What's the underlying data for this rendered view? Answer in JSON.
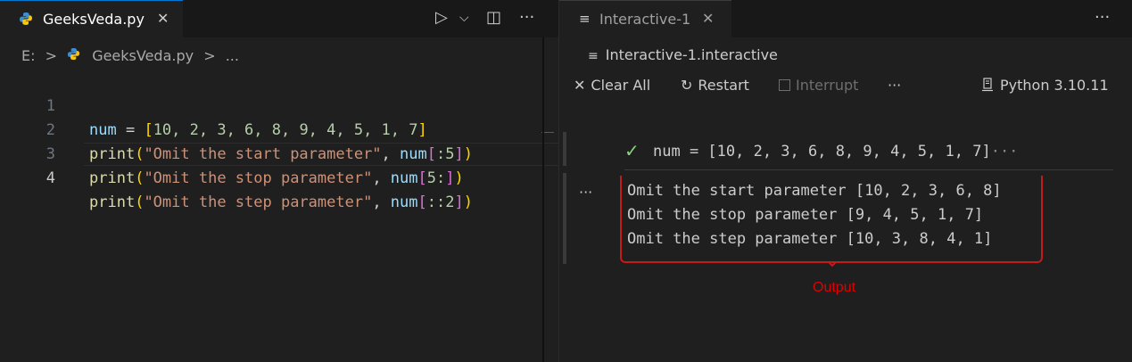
{
  "left_editor": {
    "tab": {
      "title": "GeeksVeda.py",
      "close": "✕"
    },
    "toolbar": {
      "run": "▷",
      "run_menu": "⌵",
      "split": "◫",
      "more": "···"
    },
    "breadcrumb": {
      "drive": "E:",
      "sep1": ">",
      "file": "GeeksVeda.py",
      "sep2": ">",
      "more": "..."
    },
    "lines": [
      {
        "n": "1",
        "tokens": [
          "num",
          " = ",
          "[",
          "10, 2, 3, 6, 8, 9, 4, 5, 1, 7",
          "]"
        ]
      },
      {
        "n": "2",
        "tokens": [
          "print",
          "(",
          "\"Omit the start parameter\"",
          ", ",
          "num",
          "[",
          ":5",
          "]",
          ")"
        ]
      },
      {
        "n": "3",
        "tokens": [
          "print",
          "(",
          "\"Omit the stop parameter\"",
          ", ",
          "num",
          "[",
          "5:",
          "]",
          ")"
        ]
      },
      {
        "n": "4",
        "tokens": [
          "print",
          "(",
          "\"Omit the step parameter\"",
          ", ",
          "num",
          "[",
          "::2",
          "]",
          ")"
        ]
      }
    ]
  },
  "right_panel": {
    "tab": {
      "title": "Interactive-1",
      "close": "✕",
      "icon": "list-icon"
    },
    "more": "···",
    "breadcrumb": "Interactive-1.interactive",
    "toolbar": {
      "clear_all": "Clear All",
      "restart": "Restart",
      "interrupt": "Interrupt",
      "more": "···",
      "kernel": "Python 3.10.11"
    },
    "cell_input": "num = [10, 2, 3, 6, 8, 9, 4, 5, 1, 7]",
    "cell_input_more": "···",
    "output_more": "···",
    "output_lines": [
      "Omit the start parameter [10, 2, 3, 6, 8]",
      "Omit the stop parameter [9, 4, 5, 1, 7]",
      "Omit the step parameter [10, 3, 8, 4, 1]"
    ],
    "annotation": "Output"
  },
  "colors": {
    "background": "#1f1f1f",
    "annotation_red": "#e00000",
    "success_green": "#89d185",
    "accent_blue": "#0078d4"
  }
}
